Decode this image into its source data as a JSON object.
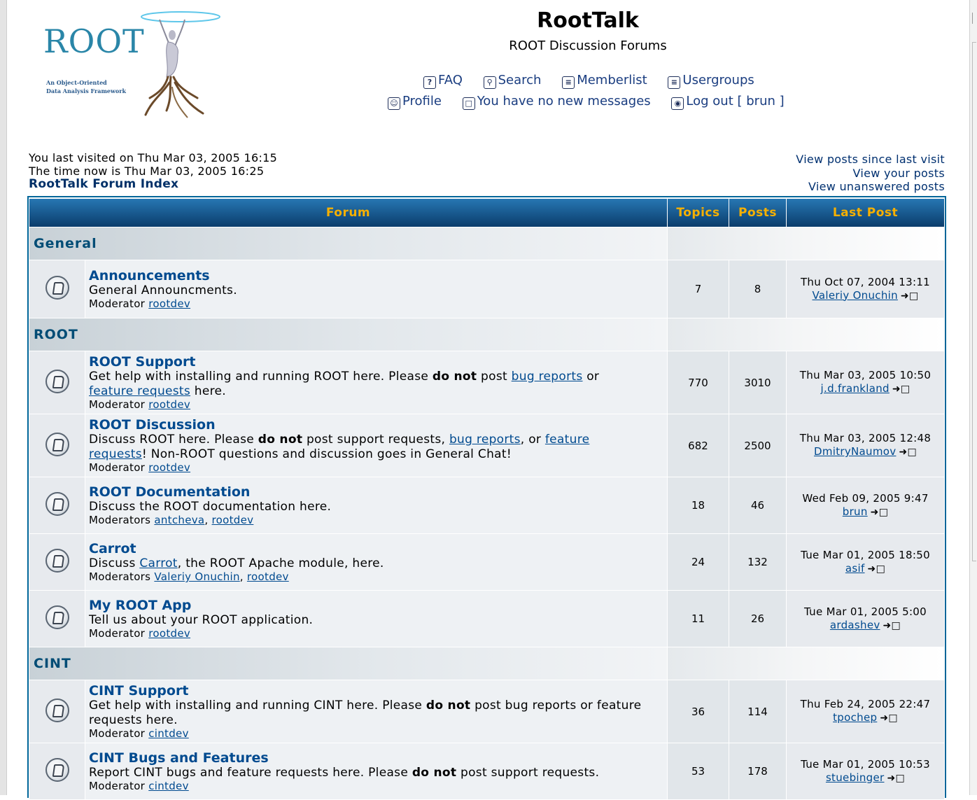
{
  "logo": {
    "word": "ROOT",
    "tagline_1": "An Object-Oriented",
    "tagline_2": "Data Analysis Framework"
  },
  "site": {
    "title": "RootTalk",
    "description": "ROOT Discussion Forums"
  },
  "nav": {
    "faq": "FAQ",
    "search": "Search",
    "memberlist": "Memberlist",
    "usergroups": "Usergroups",
    "profile": "Profile",
    "messages": "You have no new messages",
    "logout": "Log out [ brun ]"
  },
  "info": {
    "last_visit": "You last visited on Thu Mar 03, 2005 16:15",
    "time_now": "The time now is Thu Mar 03, 2005 16:25",
    "index_link": "RootTalk Forum Index"
  },
  "quick_links": {
    "since_last": "View posts since last visit",
    "your_posts": "View your posts",
    "unanswered": "View unanswered posts"
  },
  "table": {
    "headers": {
      "forum": "Forum",
      "topics": "Topics",
      "posts": "Posts",
      "last_post": "Last Post"
    },
    "categories": {
      "general": "General",
      "root": "ROOT",
      "cint": "CINT"
    },
    "forums": [
      {
        "name": "Announcements",
        "desc": "General Announcments.",
        "mod_label": "Moderator",
        "mods": "rootdev",
        "topics": "7",
        "posts": "8",
        "last_date": "Thu Oct 07, 2004 13:11",
        "last_user": "Valeriy Onuchin"
      },
      {
        "name": "ROOT Support",
        "desc_a": "Get help with installing and running ROOT here. Please ",
        "desc_bold": "do not",
        "desc_b": " post ",
        "desc_link1": "bug reports",
        "desc_c": " or",
        "desc_link2": "feature requests",
        "desc_d": " here.",
        "mod_label": "Moderator",
        "mods": "rootdev",
        "topics": "770",
        "posts": "3010",
        "last_date": "Thu Mar 03, 2005 10:50",
        "last_user": "j.d.frankland"
      },
      {
        "name": "ROOT Discussion",
        "desc_a": "Discuss ROOT here. Please ",
        "desc_bold": "do not",
        "desc_b": " post support requests, ",
        "desc_link1": "bug reports",
        "desc_c": ", or ",
        "desc_link2a": "feature",
        "desc_link2b": "requests",
        "desc_d": "! Non-ROOT questions and discussion goes in General Chat!",
        "mod_label": "Moderator",
        "mods": "rootdev",
        "topics": "682",
        "posts": "2500",
        "last_date": "Thu Mar 03, 2005 12:48",
        "last_user": "DmitryNaumov"
      },
      {
        "name": "ROOT Documentation",
        "desc": "Discuss the ROOT documentation here.",
        "mod_label": "Moderators",
        "mod1": "antcheva",
        "mod2": "rootdev",
        "topics": "18",
        "posts": "46",
        "last_date": "Wed Feb 09, 2005 9:47",
        "last_user": "brun"
      },
      {
        "name": "Carrot",
        "desc_a": "Discuss ",
        "desc_link": "Carrot",
        "desc_b": ", the ROOT Apache module, here.",
        "mod_label": "Moderators",
        "mod1": "Valeriy Onuchin",
        "mod2": "rootdev",
        "topics": "24",
        "posts": "132",
        "last_date": "Tue Mar 01, 2005 18:50",
        "last_user": "asif"
      },
      {
        "name": "My ROOT App",
        "desc": "Tell us about your ROOT application.",
        "mod_label": "Moderator",
        "mods": "rootdev",
        "topics": "11",
        "posts": "26",
        "last_date": "Tue Mar 01, 2005 5:00",
        "last_user": "ardashev"
      },
      {
        "name": "CINT Support",
        "desc_a": "Get help with installing and running CINT here. Please ",
        "desc_bold": "do not",
        "desc_b": " post bug reports or feature requests here.",
        "mod_label": "Moderator",
        "mods": "cintdev",
        "topics": "36",
        "posts": "114",
        "last_date": "Thu Feb 24, 2005 22:47",
        "last_user": "tpochep"
      },
      {
        "name": "CINT Bugs and Features",
        "desc_a": "Report CINT bugs and feature requests here. Please ",
        "desc_bold": "do not",
        "desc_b": " post support requests.",
        "mod_label": "Moderator",
        "mods": "cintdev",
        "topics": "53",
        "posts": "178",
        "last_date": "Tue Mar 01, 2005 10:53",
        "last_user": "stuebinger"
      }
    ]
  },
  "colors": {
    "header_gradient_top": "#2777b3",
    "header_gradient_bottom": "#0b3d6c",
    "header_text": "#f7b000",
    "link": "#004a8f",
    "table_border": "#006699"
  }
}
